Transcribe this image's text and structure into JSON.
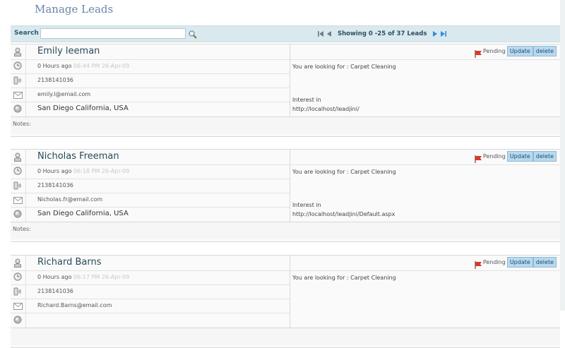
{
  "page": {
    "title": "Manage Leads"
  },
  "search": {
    "label": "Search",
    "value": "",
    "placeholder": ""
  },
  "pager": {
    "showing": "Showing 0 -25 of 37 Leads"
  },
  "leads": [
    {
      "name": "Emily leeman",
      "time_ago": "0 Hours ago",
      "timestamp": "06:44 PM 26-Apr-09",
      "phone": "2138141036",
      "email": "emily.l@email.com",
      "location": "San Diego California, USA",
      "status": "Pending",
      "update_label": "Update",
      "delete_label": "delete",
      "looking_for": "You are looking for : Carpet Cleaning",
      "interest_label": "Interest in",
      "interest_url": "http://localhost/leadjini/",
      "notes_label": "Notes:"
    },
    {
      "name": "Nicholas Freeman",
      "time_ago": "0 Hours ago",
      "timestamp": "06:18 PM 26-Apr-09",
      "phone": "2138141036",
      "email": "Nicholas.fr@email.com",
      "location": "San Diego California, USA",
      "status": "Pending",
      "update_label": "Update",
      "delete_label": "delete",
      "looking_for": "You are looking for : Carpet Cleaning",
      "interest_label": "Interest in",
      "interest_url": "http://localhost/leadjini/Default.aspx",
      "notes_label": "Notes:"
    },
    {
      "name": "Richard Barns",
      "time_ago": "0 Hours ago",
      "timestamp": "06:17 PM 26-Apr-09",
      "phone": "2138141036",
      "email": "Richard.Barns@email.com",
      "location": "",
      "status": "Pending",
      "update_label": "Update",
      "delete_label": "delete",
      "looking_for": "You are looking for : Carpet Cleaning",
      "interest_label": "",
      "interest_url": "",
      "notes_label": ""
    }
  ],
  "colors": {
    "header_bar": "#d9e9ee",
    "title": "#6a86a8",
    "button": "#b9d9ef",
    "flag": "#d83b2e"
  }
}
